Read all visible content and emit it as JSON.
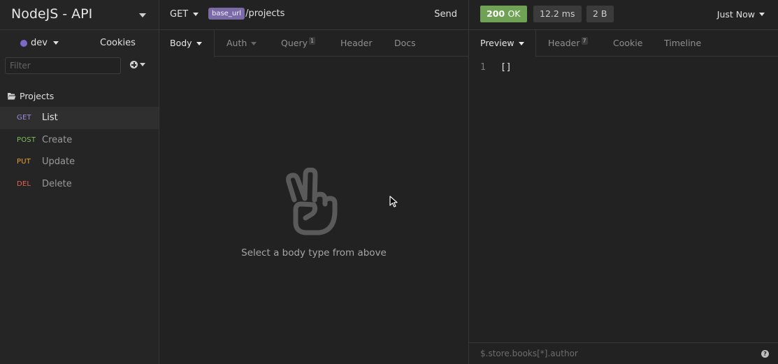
{
  "sidebar": {
    "workspace_title": "NodeJS - API",
    "environment": "dev",
    "environment_color": "#7d69cb",
    "cookies_label": "Cookies",
    "filter_placeholder": "Filter",
    "folder": "Projects",
    "requests": [
      {
        "method": "GET",
        "name": "List",
        "active": true
      },
      {
        "method": "POST",
        "name": "Create",
        "active": false
      },
      {
        "method": "PUT",
        "name": "Update",
        "active": false
      },
      {
        "method": "DEL",
        "name": "Delete",
        "active": false
      }
    ]
  },
  "request": {
    "method": "GET",
    "url_tag": "base_url",
    "url_path": "/projects",
    "send_label": "Send",
    "tabs": {
      "body": "Body",
      "auth": "Auth",
      "query": "Query",
      "query_count": "1",
      "header": "Header",
      "docs": "Docs"
    },
    "empty_message": "Select a body type from above"
  },
  "response": {
    "status_code": "200",
    "status_text": "OK",
    "status_color": "#6fa254",
    "timing": "12.2 ms",
    "size": "2 B",
    "time_label": "Just Now",
    "tabs": {
      "preview": "Preview",
      "header": "Header",
      "header_count": "7",
      "cookie": "Cookie",
      "timeline": "Timeline"
    },
    "line_number": "1",
    "body": "[]",
    "filter_placeholder": "$.store.books[*].author",
    "help_glyph": "?"
  }
}
